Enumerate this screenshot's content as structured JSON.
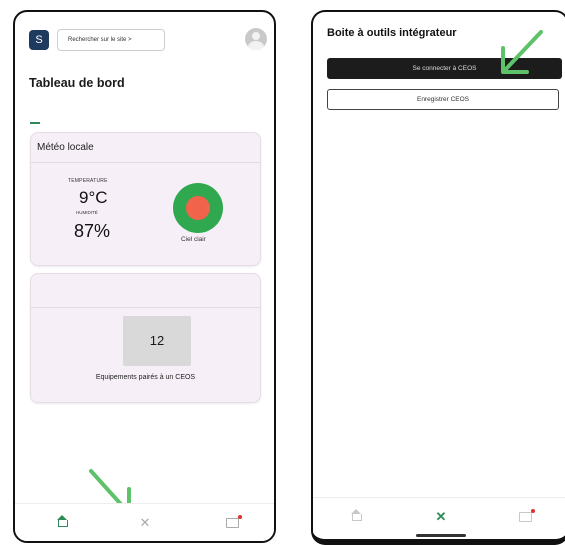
{
  "left_screen": {
    "header": {
      "logo_letter": "S",
      "search_label": "Rechercher sur le site >"
    },
    "page_title": "Tableau de bord",
    "weather_card": {
      "title": "Météo locale",
      "temperature_label": "TEMPERATURE",
      "temperature_value": "9°C",
      "humidity_label": "HUMIDITÉ",
      "humidity_value": "87%",
      "condition": "Ciel clair",
      "icon": "weather-sun-icon"
    },
    "devices_card": {
      "count": "12",
      "label": "Equipements pairés à un CEOS"
    },
    "bottom_nav": {
      "items": [
        {
          "icon": "home-icon",
          "active": true
        },
        {
          "icon": "tools-icon",
          "active": false
        },
        {
          "icon": "messages-icon",
          "active": false,
          "badge": true
        }
      ]
    }
  },
  "right_screen": {
    "title": "Boite à outils intégrateur",
    "connect_button": "Se connecter à CEOS",
    "register_button": "Enregistrer CEOS",
    "bottom_nav": {
      "items": [
        {
          "icon": "home-icon",
          "active": false
        },
        {
          "icon": "tools-icon",
          "active": true
        },
        {
          "icon": "messages-icon",
          "active": false,
          "badge": true
        }
      ]
    }
  },
  "colors": {
    "accent_green": "#2e8b57",
    "card_background": "#f7eff7",
    "annotation_arrow": "#5ec26a",
    "weather_icon_outer": "#2fa84f",
    "weather_icon_inner": "#f2634b",
    "notification_dot": "#e03030"
  }
}
